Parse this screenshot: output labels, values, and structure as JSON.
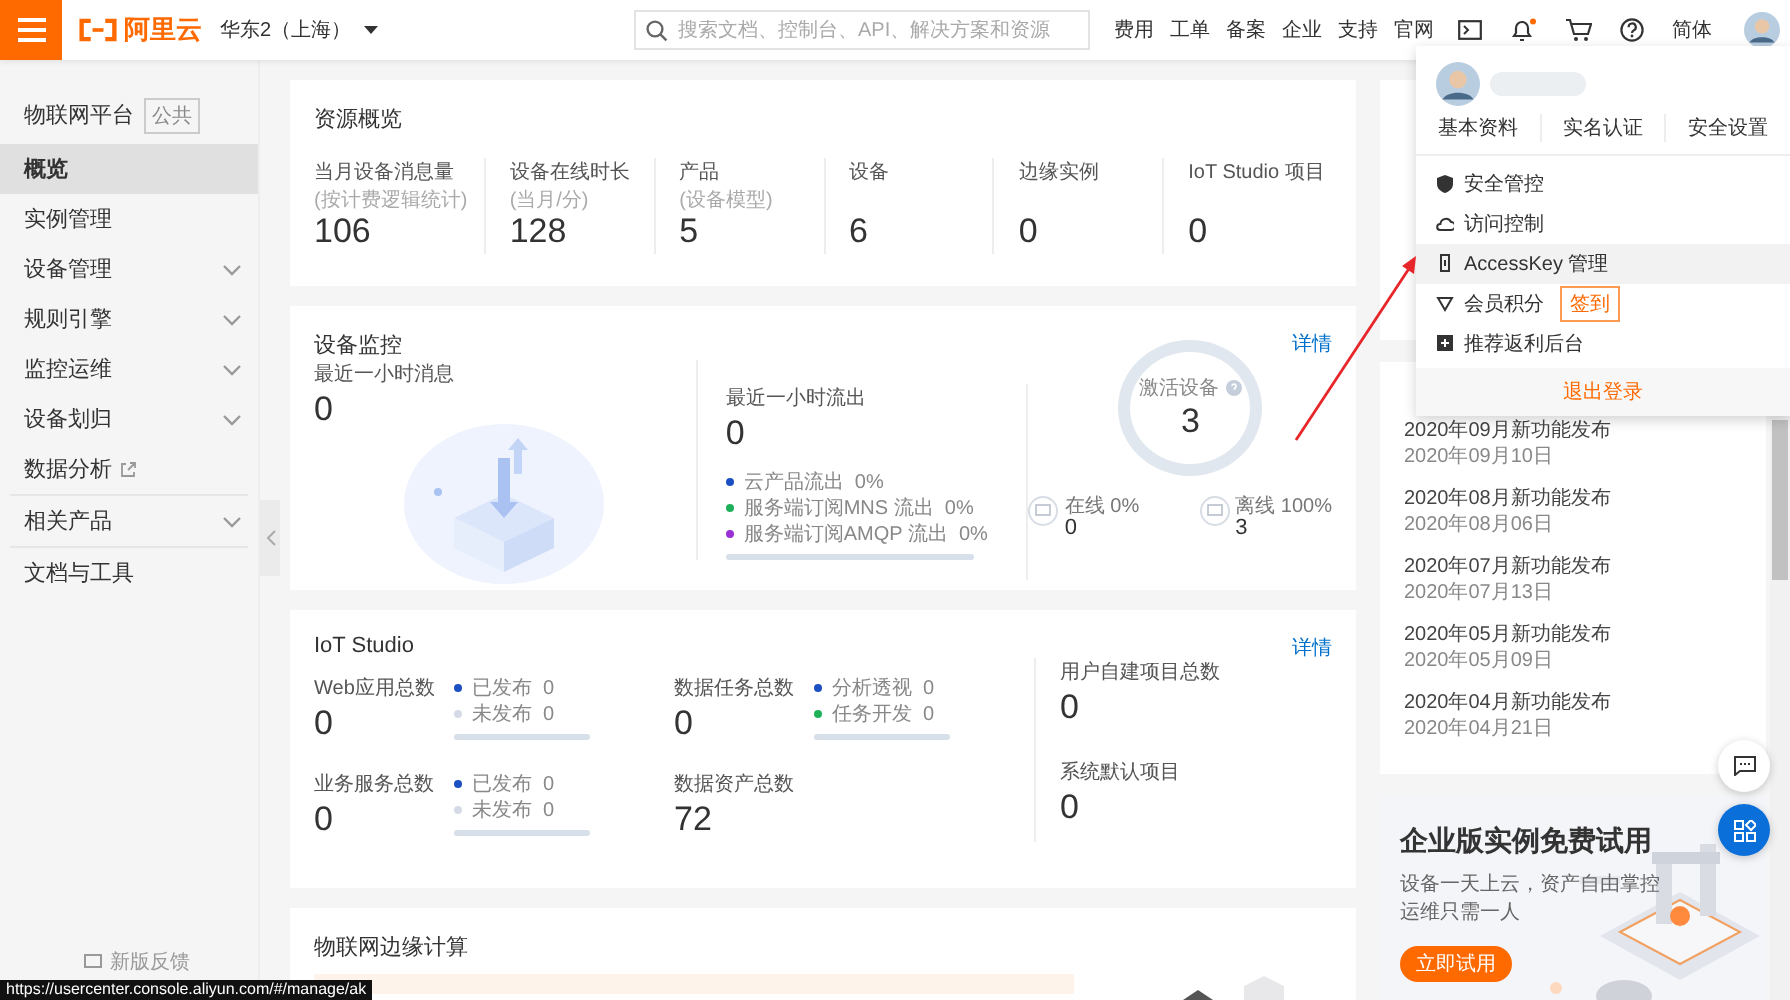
{
  "topbar": {
    "logo_text": "阿里云",
    "region": "华东2（上海）",
    "search": {
      "placeholder": "搜索文档、控制台、API、解决方案和资源"
    },
    "nav": [
      "费用",
      "工单",
      "备案",
      "企业",
      "支持",
      "官网"
    ],
    "language": "简体"
  },
  "sidebar": {
    "title": "物联网平台",
    "tag": "公共",
    "sections": [
      [
        {
          "label": "概览",
          "selected": true,
          "expandable": false,
          "external": false
        },
        {
          "label": "实例管理",
          "selected": false,
          "expandable": false,
          "external": false
        },
        {
          "label": "设备管理",
          "selected": false,
          "expandable": true,
          "external": false
        },
        {
          "label": "规则引擎",
          "selected": false,
          "expandable": true,
          "external": false
        },
        {
          "label": "监控运维",
          "selected": false,
          "expandable": true,
          "external": false
        },
        {
          "label": "设备划归",
          "selected": false,
          "expandable": true,
          "external": false
        },
        {
          "label": "数据分析",
          "selected": false,
          "expandable": false,
          "external": true
        }
      ],
      [
        {
          "label": "相关产品",
          "selected": false,
          "expandable": true,
          "external": false
        }
      ],
      [
        {
          "label": "文档与工具",
          "selected": false,
          "expandable": false,
          "external": false
        }
      ]
    ],
    "feedback": "新版反馈"
  },
  "resource_overview": {
    "title": "资源概览",
    "stats": [
      {
        "label": "当月设备消息量",
        "sublabel": "(按计费逻辑统计)",
        "value": "106"
      },
      {
        "label": "设备在线时长",
        "sublabel": "(当月/分)",
        "value": "128"
      },
      {
        "label": "产品",
        "sublabel": "(设备模型)",
        "value": "5"
      },
      {
        "label": "设备",
        "value": "6"
      },
      {
        "label": "边缘实例",
        "value": "0"
      },
      {
        "label": "IoT Studio 项目",
        "value": "0"
      }
    ]
  },
  "device_monitor": {
    "title": "设备监控",
    "link": "详情",
    "messages": {
      "label": "最近一小时消息",
      "value": "0"
    },
    "outflow": {
      "label": "最近一小时流出",
      "value": "0",
      "legend": [
        {
          "label": "云产品流出  0%",
          "color": "#1b4fc4"
        },
        {
          "label": "服务端订阅MNS 流出  0%",
          "color": "#1eb15a"
        },
        {
          "label": "服务端订阅AMQP 流出  0%",
          "color": "#9b2fd6"
        }
      ]
    },
    "active": {
      "label": "激活设备",
      "value": "3",
      "states": [
        {
          "label": "在线 0%",
          "value": "0"
        },
        {
          "label": "离线 100%",
          "value": "3"
        }
      ]
    }
  },
  "iot_studio": {
    "title": "IoT Studio",
    "link": "详情",
    "metrics": [
      {
        "label": "Web应用总数",
        "value": "0",
        "legend": [
          {
            "label": "已发布  0",
            "color": "#1b4fc4"
          },
          {
            "label": "未发布  0",
            "color": "#d5dbe6"
          }
        ]
      },
      {
        "label": "数据任务总数",
        "value": "0",
        "legend": [
          {
            "label": "分析透视  0",
            "color": "#1b4fc4"
          },
          {
            "label": "任务开发  0",
            "color": "#1eb15a"
          }
        ]
      },
      {
        "label": "业务服务总数",
        "value": "0",
        "legend": [
          {
            "label": "已发布  0",
            "color": "#1b4fc4"
          },
          {
            "label": "未发布  0",
            "color": "#d5dbe6"
          }
        ]
      },
      {
        "label": "数据资产总数",
        "value": "72"
      }
    ],
    "projects": [
      {
        "label": "用户自建项目总数",
        "value": "0"
      },
      {
        "label": "系统默认项目",
        "value": "0"
      }
    ]
  },
  "edge_computing": {
    "title": "物联网边缘计算"
  },
  "news": {
    "items": [
      {
        "title": "2020年09月新功能发布",
        "date": "2020年09月10日"
      },
      {
        "title": "2020年08月新功能发布",
        "date": "2020年08月06日"
      },
      {
        "title": "2020年07月新功能发布",
        "date": "2020年07月13日"
      },
      {
        "title": "2020年05月新功能发布",
        "date": "2020年05月09日"
      },
      {
        "title": "2020年04月新功能发布",
        "date": "2020年04月21日"
      }
    ]
  },
  "promo": {
    "title": "企业版实例免费试用",
    "lines": [
      "设备一天上云，资产自由掌控",
      "运维只需一人"
    ],
    "button": "立即试用"
  },
  "account_menu": {
    "tabs": [
      "基本资料",
      "实名认证",
      "安全设置"
    ],
    "items": [
      {
        "label": "安全管控",
        "kind": "shield",
        "selected": false
      },
      {
        "label": "访问控制",
        "kind": "cloud",
        "selected": false
      },
      {
        "label": "AccessKey 管理",
        "kind": "key",
        "selected": true
      },
      {
        "label": "会员积分",
        "kind": "points",
        "selected": false,
        "badge": "签到"
      },
      {
        "label": "推荐返利后台",
        "kind": "gift",
        "selected": false
      }
    ],
    "logout": "退出登录"
  },
  "status_url": "https://usercenter.console.aliyun.com/#/manage/ak"
}
